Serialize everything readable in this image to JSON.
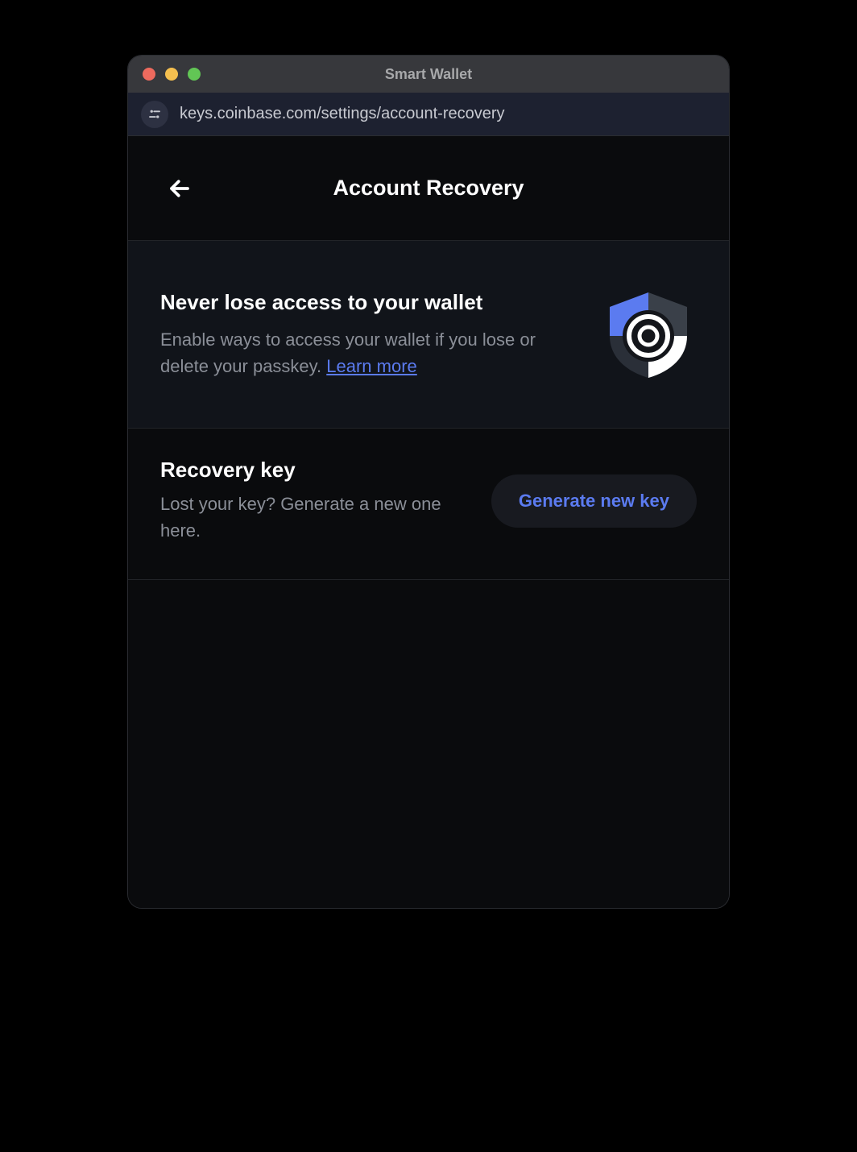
{
  "window": {
    "title": "Smart Wallet"
  },
  "urlbar": {
    "url": "keys.coinbase.com/settings/account-recovery"
  },
  "header": {
    "title": "Account Recovery"
  },
  "info": {
    "heading": "Never lose access to your wallet",
    "body_prefix": "Enable ways to access your wallet if you lose or delete your passkey. ",
    "learn_more": "Learn more"
  },
  "recovery": {
    "heading": "Recovery key",
    "body": "Lost your key? Generate a new one here.",
    "button": "Generate new key"
  },
  "colors": {
    "accent": "#5b7bf0"
  }
}
